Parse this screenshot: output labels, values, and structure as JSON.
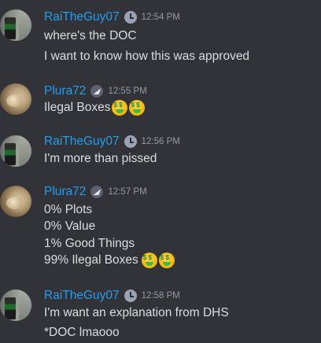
{
  "messages": [
    {
      "author": "RaiTheGuy07",
      "time": "12:54 PM",
      "badge_icon": "clock-icon",
      "lines": [
        "where's the DOC",
        "I want to know how this was approved"
      ]
    },
    {
      "author": "Plura72",
      "time": "12:55 PM",
      "badge_icon": "paper-plane-icon",
      "lines": [
        "Ilegal Boxes"
      ]
    },
    {
      "author": "RaiTheGuy07",
      "time": "12:56 PM",
      "badge_icon": "clock-icon",
      "lines": [
        "I'm more than pissed"
      ]
    },
    {
      "author": "Plura72",
      "time": "12:57 PM",
      "badge_icon": "paper-plane-icon",
      "lines": [
        "0% Plots",
        "0% Value",
        "1% Good Things",
        "99% Ilegal Boxes"
      ]
    },
    {
      "author": "RaiTheGuy07",
      "time": "12:58 PM",
      "badge_icon": "clock-icon",
      "lines": [
        "I'm want an explanation from DHS",
        "*DOC lmaooo"
      ]
    }
  ],
  "emoji": "money-mouth-face-icon",
  "colors": {
    "background": "#313338",
    "username": "#1f9ff0",
    "text": "#dbdee1",
    "timestamp": "#949ba4"
  }
}
